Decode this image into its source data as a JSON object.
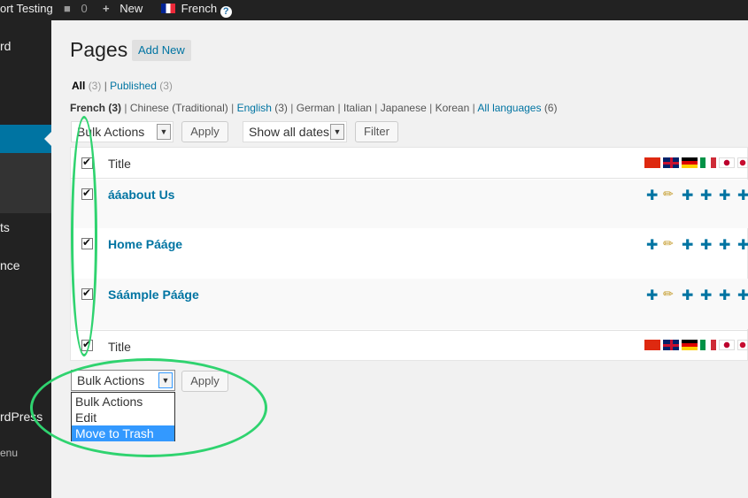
{
  "adminbar": {
    "site_name": "ort Testing",
    "comments_count": "0",
    "new_label": "New",
    "language_label": "French"
  },
  "sidebar": {
    "items": [
      "rd",
      "ts",
      "nce",
      "rdPress",
      "enu"
    ]
  },
  "page": {
    "title": "Pages",
    "add_new": "Add New"
  },
  "views": {
    "all_label": "All",
    "all_count": "(3)",
    "published_label": "Published",
    "published_count": "(3)"
  },
  "languages": [
    {
      "label": "French",
      "count": "(3)"
    },
    {
      "label": "Chinese (Traditional)",
      "count": ""
    },
    {
      "label": "English",
      "count": "(3)"
    },
    {
      "label": "German",
      "count": ""
    },
    {
      "label": "Italian",
      "count": ""
    },
    {
      "label": "Japanese",
      "count": ""
    },
    {
      "label": "Korean",
      "count": ""
    },
    {
      "label": "All languages",
      "count": "(6)"
    }
  ],
  "toolbar": {
    "bulk_actions": "Bulk Actions",
    "apply": "Apply",
    "dates": "Show all dates",
    "filter": "Filter"
  },
  "table": {
    "header_title": "Title",
    "footer_title": "Title",
    "rows": [
      {
        "title": "ááabout Us"
      },
      {
        "title": "Home Pááge"
      },
      {
        "title": "Sáámple Pááge"
      }
    ]
  },
  "flag_colors": {
    "china": "#de2910",
    "uk_blue": "#012169",
    "uk_red": "#c8102e",
    "de_black": "#000000",
    "de_red": "#dd0000",
    "de_gold": "#ffce00",
    "it_green": "#009246",
    "it_red": "#ce2b37",
    "jp_red": "#bc002d"
  },
  "bottom_toolbar": {
    "bulk_actions": "Bulk Actions",
    "apply": "Apply",
    "options": [
      "Bulk Actions",
      "Edit",
      "Move to Trash"
    ],
    "selected_index": 2
  }
}
